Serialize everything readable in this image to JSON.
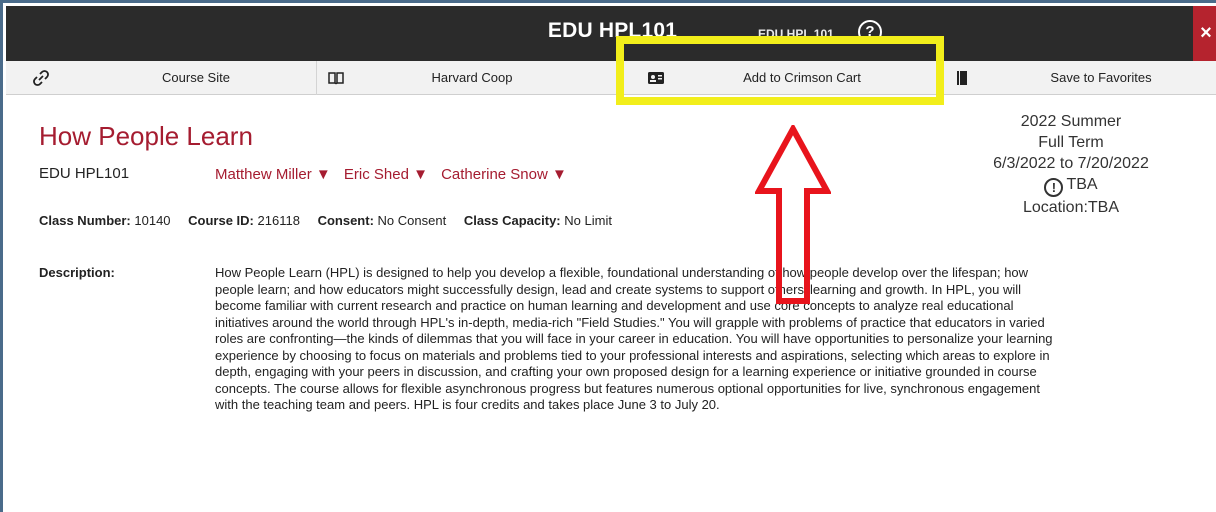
{
  "window": {
    "title": "EDU HPL101",
    "ghost_title": "EDU HPL 101",
    "help_glyph": "?",
    "close_glyph": "×"
  },
  "toolbar": {
    "items": [
      {
        "label": "Course Site",
        "icon": "link-icon"
      },
      {
        "label": "Harvard Coop",
        "icon": "book-icon"
      },
      {
        "label": "Add to Crimson Cart",
        "icon": "id-card-icon"
      },
      {
        "label": "Save to Favorites",
        "icon": "bookmark-icon"
      }
    ]
  },
  "course": {
    "title": "How People Learn",
    "code": "EDU HPL101",
    "instructors": [
      "Matthew Miller ▼",
      "Eric Shed ▼",
      "Catherine Snow ▼"
    ]
  },
  "schedule": {
    "term": "2022 Summer",
    "session": "Full Term",
    "dates": "6/3/2022 to 7/20/2022",
    "tba_glyph": "!",
    "time": "TBA",
    "location": "Location:TBA"
  },
  "facts": [
    {
      "key": "Class Number:",
      "value": "10140"
    },
    {
      "key": "Course ID:",
      "value": "216118"
    },
    {
      "key": "Consent:",
      "value": "No Consent"
    },
    {
      "key": "Class Capacity:",
      "value": "No Limit"
    }
  ],
  "description": {
    "label": "Description:",
    "text": "How People Learn (HPL) is designed to help you develop a flexible, foundational understanding of how people develop over the lifespan; how people learn; and how educators might successfully design, lead and create systems to support others' learning and growth. In HPL, you will become familiar with current research and practice on human learning and development and use core concepts to analyze real educational initiatives around the world through HPL's in-depth, media-rich \"Field Studies.\" You will grapple with problems of practice that educators in varied roles are confronting—the kinds of dilemmas that you will face in your career in education. You will have opportunities to personalize your learning experience by choosing to focus on materials and problems tied to your professional interests and aspirations, selecting which areas to explore in depth, engaging with your peers in discussion, and crafting your own proposed design for a learning experience or initiative grounded in course concepts. The course allows for flexible asynchronous progress but features numerous optional opportunities for live, synchronous engagement with the teaching team and peers. HPL is four credits and takes place June 3 to July 20."
  },
  "colors": {
    "accent": "#a51c30",
    "highlight": "#f2ee1b",
    "arrow": "#e8141c",
    "titlebar": "#2b2b2b"
  }
}
